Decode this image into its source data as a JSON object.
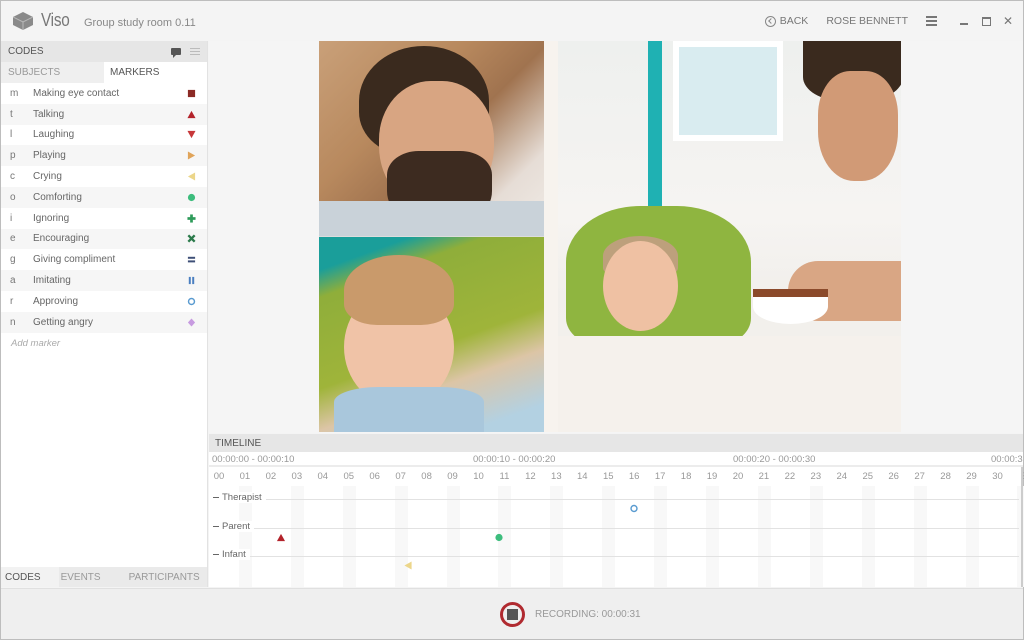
{
  "titlebar": {
    "app_name": "Viso",
    "room_name": "Group study room 0.11",
    "back_label": "BACK",
    "user_name": "ROSE BENNETT"
  },
  "sidebar": {
    "header": "CODES",
    "subtabs": [
      {
        "label": "SUBJECTS",
        "active": false
      },
      {
        "label": "MARKERS",
        "active": true
      }
    ],
    "markers": [
      {
        "key": "m",
        "label": "Making eye contact",
        "icon": "square-icon",
        "color": "#8b2a25"
      },
      {
        "key": "t",
        "label": "Talking",
        "icon": "triangle-up-icon",
        "color": "#b3232b"
      },
      {
        "key": "l",
        "label": "Laughing",
        "icon": "triangle-down-icon",
        "color": "#c7383a"
      },
      {
        "key": "p",
        "label": "Playing",
        "icon": "triangle-right-icon",
        "color": "#e0a45a"
      },
      {
        "key": "c",
        "label": "Crying",
        "icon": "triangle-left-icon",
        "color": "#ecd68a"
      },
      {
        "key": "o",
        "label": "Comforting",
        "icon": "circle-icon",
        "color": "#3dbd7d"
      },
      {
        "key": "i",
        "label": "Ignoring",
        "icon": "plus-icon",
        "color": "#2e9b5a"
      },
      {
        "key": "e",
        "label": "Encouraging",
        "icon": "cross-icon",
        "color": "#2b7a4b"
      },
      {
        "key": "g",
        "label": "Giving compliment",
        "icon": "equals-icon",
        "color": "#3e4f77"
      },
      {
        "key": "a",
        "label": "Imitating",
        "icon": "pause-icon",
        "color": "#4a7fc1"
      },
      {
        "key": "r",
        "label": "Approving",
        "icon": "ring-icon",
        "color": "#5a9bd0"
      },
      {
        "key": "n",
        "label": "Getting angry",
        "icon": "diamond-icon",
        "color": "#c79be0"
      }
    ],
    "add_marker": "Add marker",
    "bottom_tabs": [
      {
        "label": "CODES",
        "active": true
      },
      {
        "label": "EVENTS",
        "active": false
      },
      {
        "label": "PARTICIPANTS",
        "active": false
      }
    ]
  },
  "timeline": {
    "header": "TIMELINE",
    "ranges": [
      "00:00:00 - 00:00:10",
      "00:00:10 - 00:00:20",
      "00:00:20 - 00:00:30",
      "00:00:3"
    ],
    "ticks": [
      "00",
      "01",
      "02",
      "03",
      "04",
      "05",
      "06",
      "07",
      "08",
      "09",
      "10",
      "11",
      "12",
      "13",
      "14",
      "15",
      "16",
      "17",
      "18",
      "19",
      "20",
      "21",
      "22",
      "23",
      "24",
      "25",
      "26",
      "27",
      "28",
      "29",
      "30"
    ],
    "rows": [
      "Therapist",
      "Parent",
      "Infant"
    ],
    "events": [
      {
        "row": "Therapist",
        "second": 16.0,
        "marker": "Approving",
        "icon": "ring-icon",
        "color": "#5a9bd0"
      },
      {
        "row": "Parent",
        "second": 2.4,
        "marker": "Talking",
        "icon": "triangle-up-icon",
        "color": "#b3232b"
      },
      {
        "row": "Parent",
        "second": 10.8,
        "marker": "Comforting",
        "icon": "circle-icon",
        "color": "#3dbd7d"
      },
      {
        "row": "Infant",
        "second": 7.3,
        "marker": "Crying",
        "icon": "triangle-left-icon",
        "color": "#ecd68a"
      }
    ]
  },
  "recording": {
    "label": "RECORDING: 00:00:31"
  }
}
